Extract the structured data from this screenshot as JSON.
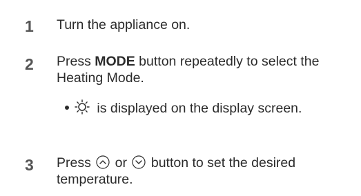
{
  "steps": [
    {
      "number": "1",
      "text": "Turn the appliance on."
    },
    {
      "number": "2",
      "pre": "Press ",
      "bold": "MODE",
      "post": " button repeatedly to select the Heating Mode.",
      "bullet": {
        "icon": "sun-icon",
        "text": " is displayed on the display screen."
      }
    },
    {
      "number": "3",
      "pre": "Press ",
      "icon_up": "chevron-up-circle-icon",
      "mid": " or ",
      "icon_down": "chevron-down-circle-icon",
      "post": " button to set the desired temperature."
    }
  ],
  "colors": {
    "step_number": "#555555",
    "text": "#2b2b2b"
  }
}
